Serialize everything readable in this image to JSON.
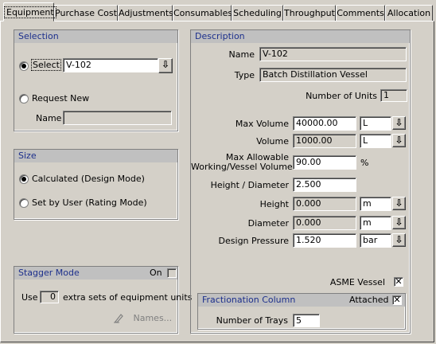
{
  "tabs": [
    "Equipment",
    "Purchase Cost",
    "Adjustments",
    "Consumables",
    "Scheduling",
    "Throughput",
    "Comments",
    "Allocation"
  ],
  "selection": {
    "title": "Selection",
    "select_label": "Select",
    "selected_value": "V-102",
    "request_new_label": "Request New",
    "name_label": "Name",
    "name_value": ""
  },
  "size": {
    "title": "Size",
    "calculated_label": "Calculated (Design Mode)",
    "set_by_user_label": "Set by User (Rating Mode)"
  },
  "stagger": {
    "title": "Stagger Mode",
    "on_label": "On",
    "use_label": "Use",
    "count": "0",
    "suffix_label": "extra sets of equipment units",
    "names_label": "Names..."
  },
  "description": {
    "title": "Description",
    "name_label": "Name",
    "name_value": "V-102",
    "type_label": "Type",
    "type_value": "Batch Distillation Vessel",
    "units_label": "Number of Units",
    "units_value": "1",
    "max_volume_label": "Max Volume",
    "max_volume_value": "40000.00",
    "max_volume_unit": "L",
    "volume_label": "Volume",
    "volume_value": "1000.00",
    "volume_unit": "L",
    "max_allow_label_1": "Max Allowable",
    "max_allow_label_2": "Working/Vessel Volume",
    "max_allow_value": "90.00",
    "max_allow_unit": "%",
    "hd_label": "Height / Diameter",
    "hd_value": "2.500",
    "height_label": "Height",
    "height_value": "0.000",
    "height_unit": "m",
    "diameter_label": "Diameter",
    "diameter_value": "0.000",
    "diameter_unit": "m",
    "pressure_label": "Design Pressure",
    "pressure_value": "1.520",
    "pressure_unit": "bar",
    "asme_label": "ASME Vessel",
    "asme_mark": "✕"
  },
  "fractionation": {
    "title": "Fractionation Column",
    "attached_label": "Attached",
    "attached_mark": "✕",
    "trays_label": "Number of Trays",
    "trays_value": "5"
  },
  "icons": {
    "dropdown": "⇩"
  }
}
